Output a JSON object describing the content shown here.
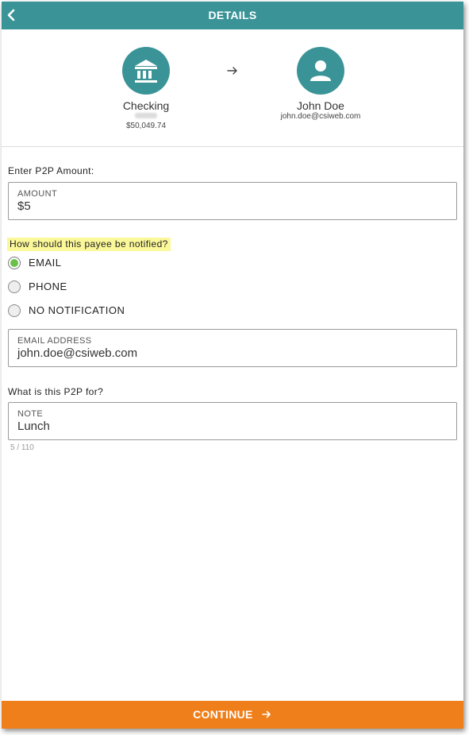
{
  "header": {
    "title": "DETAILS"
  },
  "transfer": {
    "from": {
      "name": "Checking",
      "balance": "$50,049.74"
    },
    "to": {
      "name": "John Doe",
      "email": "john.doe@csiweb.com"
    }
  },
  "amount": {
    "section_label": "Enter P2P Amount:",
    "field_label": "AMOUNT",
    "value": "$5"
  },
  "notify": {
    "question": "How should this payee be notified?",
    "options": [
      {
        "label": "EMAIL",
        "selected": true
      },
      {
        "label": "PHONE",
        "selected": false
      },
      {
        "label": "NO NOTIFICATION",
        "selected": false
      }
    ]
  },
  "email": {
    "field_label": "EMAIL ADDRESS",
    "value": "john.doe@csiweb.com"
  },
  "note": {
    "section_label": "What is this P2P for?",
    "field_label": "NOTE",
    "value": "Lunch",
    "counter": "5 / 110"
  },
  "footer": {
    "continue_label": "CONTINUE"
  },
  "colors": {
    "header": "#3a9497",
    "accent": "#ef7f1a",
    "radio_selected": "#6cc04a",
    "highlight": "#fbf89a"
  }
}
